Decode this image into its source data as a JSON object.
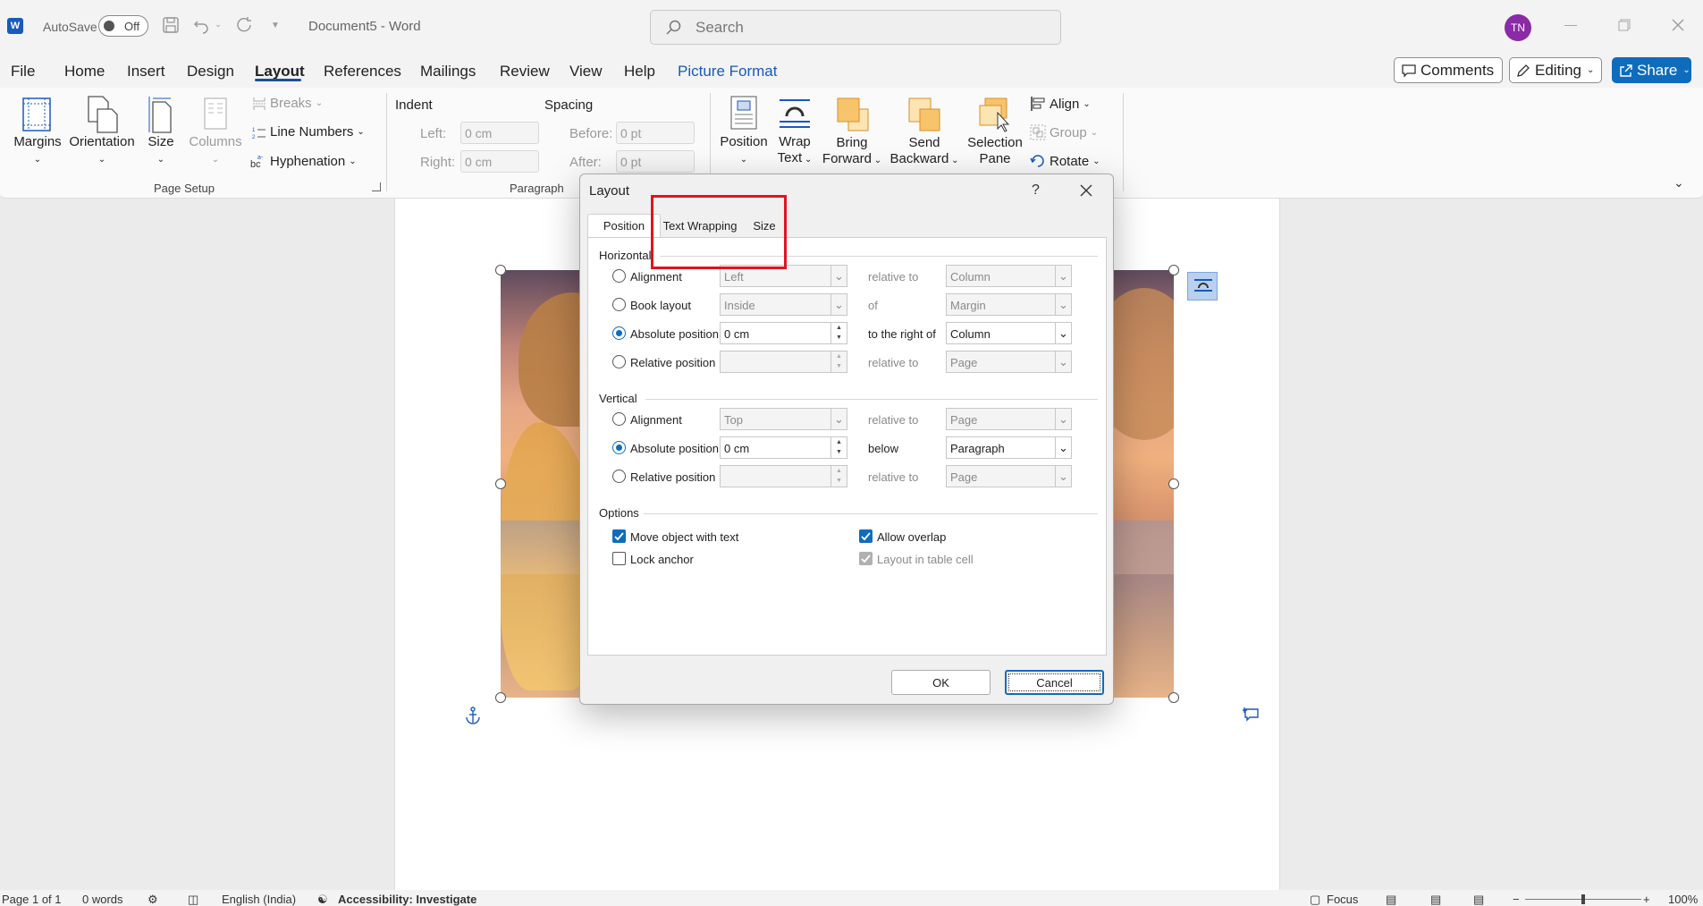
{
  "titlebar": {
    "autosave_label": "AutoSave",
    "autosave_state": "Off",
    "doc_title": "Document5  -  Word",
    "search_placeholder": "Search",
    "avatar_initials": "TN"
  },
  "menu": {
    "tabs": [
      "File",
      "Home",
      "Insert",
      "Design",
      "Layout",
      "References",
      "Mailings",
      "Review",
      "View",
      "Help",
      "Picture Format"
    ],
    "active": "Layout",
    "comments": "Comments",
    "editing": "Editing",
    "share": "Share",
    "accent": "#0f6cbd"
  },
  "ribbon": {
    "page_setup": {
      "margins": "Margins",
      "orientation": "Orientation",
      "size": "Size",
      "columns": "Columns",
      "breaks": "Breaks",
      "line_numbers": "Line Numbers",
      "hyphenation": "Hyphenation",
      "group_label": "Page Setup"
    },
    "paragraph": {
      "indent": "Indent",
      "spacing": "Spacing",
      "left": "Left:",
      "right": "Right:",
      "before": "Before:",
      "after": "After:",
      "left_val": "0 cm",
      "right_val": "0 cm",
      "before_val": "0 pt",
      "after_val": "0 pt",
      "group_label": "Paragraph"
    },
    "arrange": {
      "position": "Position",
      "wrap_text_1": "Wrap",
      "wrap_text_2": "Text",
      "bring_forward_1": "Bring",
      "bring_forward_2": "Forward",
      "send_backward_1": "Send",
      "send_backward_2": "Backward",
      "selection_pane_1": "Selection",
      "selection_pane_2": "Pane",
      "align": "Align",
      "group": "Group",
      "rotate": "Rotate"
    }
  },
  "dialog": {
    "title": "Layout",
    "help": "?",
    "tabs": [
      "Position",
      "Text Wrapping",
      "Size"
    ],
    "horizontal": {
      "heading": "Horizontal",
      "rows": [
        {
          "label": "Alignment",
          "value": "Left",
          "rel": "relative to",
          "target": "Column",
          "selected": false
        },
        {
          "label": "Book layout",
          "value": "Inside",
          "rel": "of",
          "target": "Margin",
          "selected": false
        },
        {
          "label": "Absolute position",
          "value": "0 cm",
          "rel": "to the right of",
          "target": "Column",
          "selected": true
        },
        {
          "label": "Relative position",
          "value": "",
          "rel": "relative to",
          "target": "Page",
          "selected": false
        }
      ]
    },
    "vertical": {
      "heading": "Vertical",
      "rows": [
        {
          "label": "Alignment",
          "value": "Top",
          "rel": "relative to",
          "target": "Page",
          "selected": false
        },
        {
          "label": "Absolute position",
          "value": "0 cm",
          "rel": "below",
          "target": "Paragraph",
          "selected": true
        },
        {
          "label": "Relative position",
          "value": "",
          "rel": "relative to",
          "target": "Page",
          "selected": false
        }
      ]
    },
    "options": {
      "heading": "Options",
      "move_object": "Move object with text",
      "lock_anchor": "Lock anchor",
      "allow_overlap": "Allow overlap",
      "layout_in_table": "Layout in table cell"
    },
    "ok": "OK",
    "cancel": "Cancel"
  },
  "statusbar": {
    "page": "Page 1 of 1",
    "words": "0 words",
    "language": "English (India)",
    "accessibility": "Accessibility: Investigate",
    "focus": "Focus",
    "zoom": "100%"
  }
}
